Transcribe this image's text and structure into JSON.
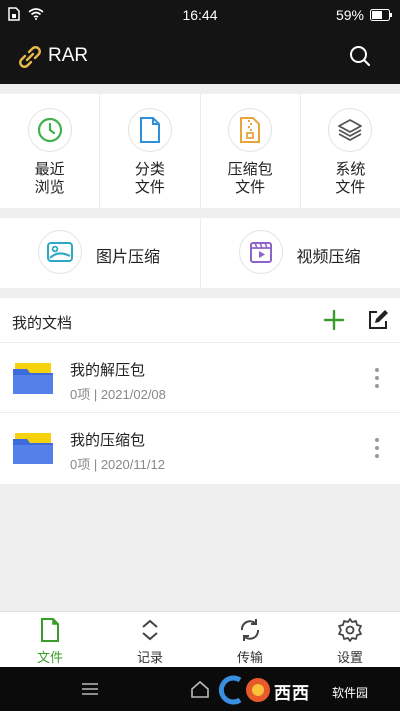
{
  "status": {
    "time": "16:44",
    "battery": "59%"
  },
  "app": {
    "title": "RAR",
    "logo": "link-icon",
    "search": "search-icon"
  },
  "tools": [
    {
      "line1": "最近",
      "line2": "浏览",
      "icon": "clock-icon",
      "color": "#3fb04a"
    },
    {
      "line1": "分类",
      "line2": "文件",
      "icon": "document-icon",
      "color": "#2f8fd8"
    },
    {
      "line1": "压缩包",
      "line2": "文件",
      "icon": "zip-file-icon",
      "color": "#e9a53b"
    },
    {
      "line1": "系统",
      "line2": "文件",
      "icon": "layers-icon",
      "color": "#555555"
    }
  ],
  "compress": [
    {
      "label": "图片压缩",
      "icon": "image-icon",
      "color": "#2aa8c4"
    },
    {
      "label": "视频压缩",
      "icon": "video-icon",
      "color": "#8e63c9"
    }
  ],
  "docs": {
    "title": "我的文档",
    "add_icon": "plus-icon",
    "edit_icon": "edit-icon",
    "items": [
      {
        "name": "我的解压包",
        "meta": "0项 | 2021/02/08"
      },
      {
        "name": "我的压缩包",
        "meta": "0项 | 2020/11/12"
      }
    ]
  },
  "tabs": [
    {
      "label": "文件",
      "icon": "file-icon",
      "active": true
    },
    {
      "label": "记录",
      "icon": "chevron-updown-icon",
      "active": false
    },
    {
      "label": "传输",
      "icon": "sync-icon",
      "active": false
    },
    {
      "label": "设置",
      "icon": "gear-icon",
      "active": false
    }
  ],
  "watermark": {
    "text": "西西",
    "sub": "软件园",
    "url": "CR173.com"
  },
  "colors": {
    "accent": "#3a9d2b",
    "folder_blue": "#3e6bdc",
    "folder_yellow": "#f5d20b",
    "dark_bar": "#141414"
  }
}
